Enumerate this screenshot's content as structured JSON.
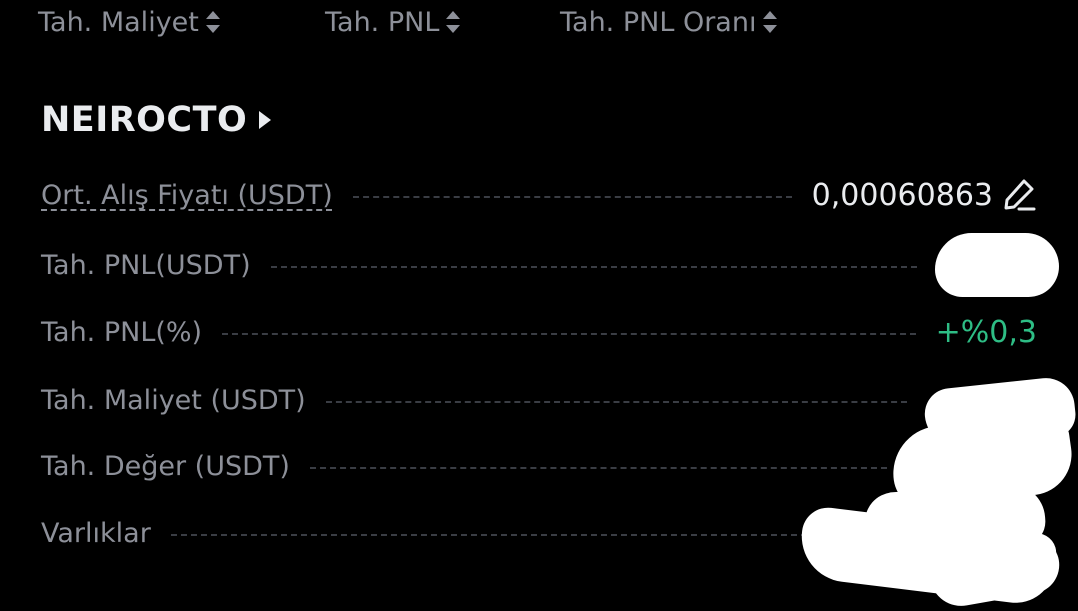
{
  "sort_header": {
    "columns": [
      {
        "label": "Tah. Maliyet"
      },
      {
        "label": "Tah. PNL"
      },
      {
        "label": "Tah. PNL Oranı"
      }
    ]
  },
  "position": {
    "symbol": "NEIROCTO",
    "rows": [
      {
        "label": "Ort. Alış Fiyatı (USDT)",
        "value": "0,00060863",
        "editable": true
      },
      {
        "label": "Tah. PNL(USDT)",
        "value": "",
        "redacted": true
      },
      {
        "label": "Tah. PNL(%)",
        "value": "+%0,3"
      },
      {
        "label": "Tah. Maliyet (USDT)",
        "value": "",
        "redacted": true
      },
      {
        "label": "Tah. Değer (USDT)",
        "value": "",
        "redacted": true
      },
      {
        "label": "Varlıklar",
        "value": "",
        "redacted": true
      }
    ]
  },
  "colors": {
    "background": "#000000",
    "label": "#8d9099",
    "value": "#eaecef",
    "positive": "#2ebd85",
    "leader": "#3a3d44",
    "redaction": "#ffffff"
  },
  "icons": {
    "sort": "sort-arrows-icon",
    "symbol_caret": "caret-right-icon",
    "edit": "edit-pencil-icon"
  }
}
